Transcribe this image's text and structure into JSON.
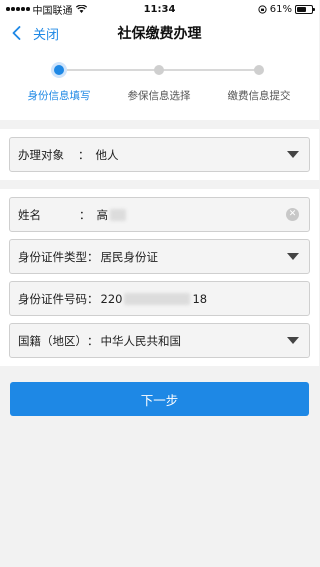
{
  "status_bar": {
    "carrier": "中国联通",
    "time": "11:34",
    "battery_percent_label": "61%",
    "battery_level": 0.61
  },
  "nav": {
    "back_label": "关闭",
    "title": "社保缴费办理"
  },
  "steps": [
    {
      "label": "身份信息填写",
      "active": true
    },
    {
      "label": "参保信息选择",
      "active": false
    },
    {
      "label": "缴费信息提交",
      "active": false
    }
  ],
  "form": {
    "handler": {
      "label": "办理对象",
      "colon": "：",
      "value": "他人"
    },
    "name": {
      "label": "姓名",
      "colon": "：",
      "value_prefix": "高"
    },
    "id_type": {
      "label": "身份证件类型",
      "colon": "：",
      "value": "居民身份证"
    },
    "id_number": {
      "label": "身份证件号码",
      "colon": "：",
      "value_prefix": "220",
      "value_suffix": "18"
    },
    "nationality": {
      "label": "国籍（地区）",
      "colon": "：",
      "value": "中华人民共和国"
    }
  },
  "submit_label": "下一步",
  "colors": {
    "accent": "#1e88e5",
    "background": "#f2f2f2"
  }
}
